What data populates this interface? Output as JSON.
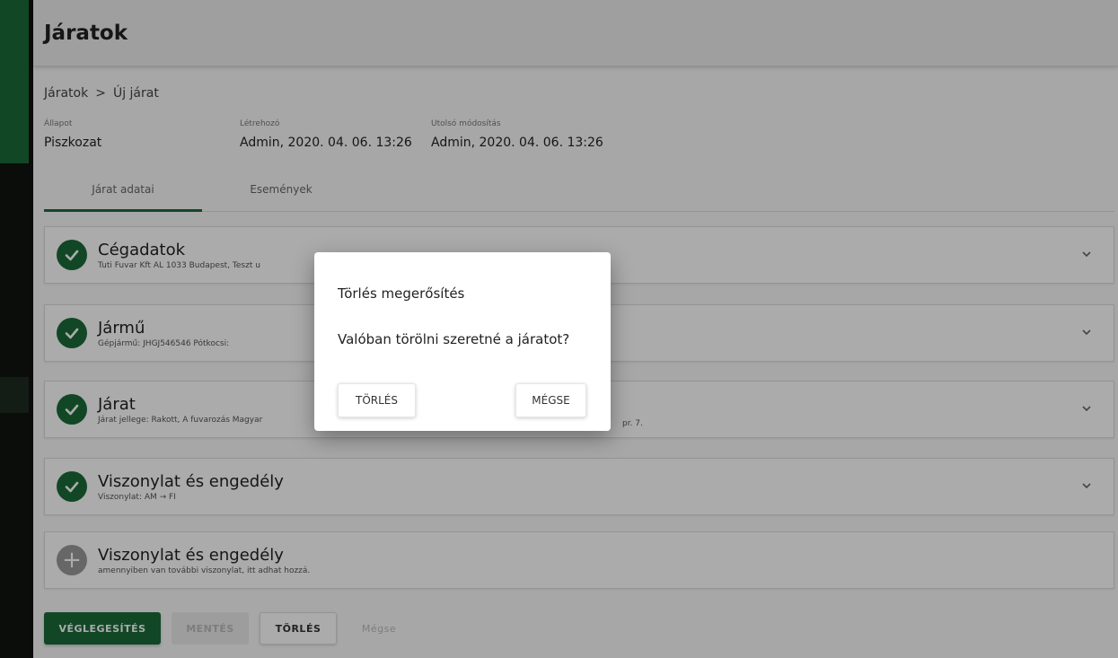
{
  "header": {
    "title": "Járatok"
  },
  "breadcrumb": {
    "parent": "Járatok",
    "separator": ">",
    "current": "Új járat"
  },
  "meta": [
    {
      "label": "Állapot",
      "value": "Piszkozat"
    },
    {
      "label": "Létrehozó",
      "value": "Admin, 2020. 04. 06. 13:26"
    },
    {
      "label": "Utolsó módosítás",
      "value": "Admin, 2020. 04. 06. 13:26"
    }
  ],
  "tabs": [
    {
      "label": "Járat adatai",
      "active": true
    },
    {
      "label": "Események",
      "active": false
    }
  ],
  "panels": [
    {
      "title": "Cégadatok",
      "subtitle": "Tuti Fuvar Kft AL 1033 Budapest, Teszt u",
      "status": "check-icon"
    },
    {
      "title": "Jármű",
      "subtitle": "Gépjármű: JHGJ546546 Pótkocsi:",
      "status": "check-icon"
    },
    {
      "title": "Járat",
      "subtitle": "Járat jellege: Rakott, A fuvarozás Magyar",
      "subtitle_tail": "pr. 7.",
      "status": "check-icon"
    },
    {
      "title": "Viszonylat és engedély",
      "subtitle": "Viszonylat: AM → FI",
      "status": "check-icon"
    },
    {
      "title": "Viszonylat és engedély",
      "subtitle": "amennyiben van további viszonylat, itt adhat hozzá.",
      "status": "plus-icon"
    }
  ],
  "actions": {
    "finalize": "VÉGLEGESÍTÉS",
    "save": "MENTÉS",
    "delete": "TÖRLÉS",
    "cancel": "Mégse"
  },
  "dialog": {
    "title": "Törlés megerősítés",
    "message": "Valóban törölni szeretné a járatot?",
    "confirm": "TÖRLÉS",
    "cancel": "MÉGSE"
  },
  "colors": {
    "accent": "#1b6b3a",
    "overlay": "rgba(0,0,0,0.33)"
  }
}
